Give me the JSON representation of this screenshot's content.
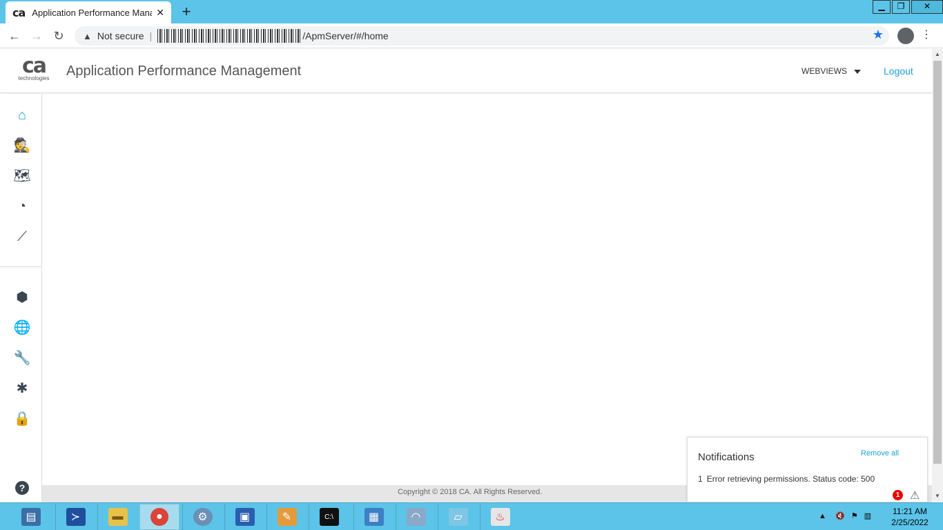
{
  "browser": {
    "tab_title": "Application Performance Manage",
    "tab_favicon": "ca",
    "new_tab": "+",
    "security_label": "Not secure",
    "url_path": "/ApmServer/#/home"
  },
  "app": {
    "logo_main": "ca",
    "logo_sub": "technologies",
    "title": "Application Performance Management",
    "webviews_label": "WEBVIEWS",
    "logout_label": "Logout",
    "accent_color": "#1a9fd9"
  },
  "sidebar": {
    "items": [
      {
        "icon": "home-icon",
        "glyph": "⌂"
      },
      {
        "icon": "agent-search-icon",
        "glyph": "🕵"
      },
      {
        "icon": "map-icon",
        "glyph": "🗺"
      },
      {
        "icon": "dashboard-icon",
        "glyph": "◔"
      },
      {
        "icon": "metrics-icon",
        "glyph": "⟋"
      },
      {
        "icon": "cube-icon",
        "glyph": "⬢"
      },
      {
        "icon": "globe-icon",
        "glyph": "🌐"
      },
      {
        "icon": "wrench-icon",
        "glyph": "🔧"
      },
      {
        "icon": "network-icon",
        "glyph": "✱"
      },
      {
        "icon": "lock-icon",
        "glyph": "🔒"
      }
    ],
    "help_glyph": "?"
  },
  "footer": {
    "copyright": "Copyright © 2018 CA. All Rights Reserved."
  },
  "notifications": {
    "title": "Notifications",
    "remove_all": "Remove all",
    "count": "1",
    "message": "Error retrieving permissions. Status code: 500",
    "badge": "1"
  },
  "taskbar": {
    "time": "11:21 AM",
    "date": "2/25/2022"
  }
}
